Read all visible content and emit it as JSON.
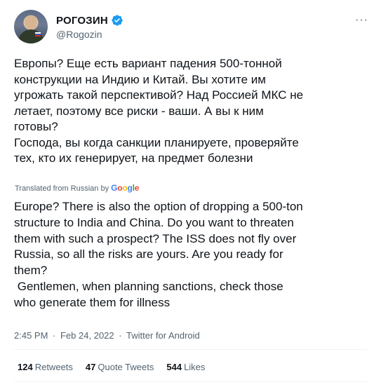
{
  "author": {
    "display_name": "РОГОЗИН",
    "handle": "@Rogozin",
    "verified_icon": "verified-badge-icon",
    "avatar_icon": "profile-photo"
  },
  "more_icon": "···",
  "tweet": {
    "original_text": "Европы? Еще есть вариант падения 500-тонной\nконструкции на Индию и Китай. Вы хотите им\nугрожать такой перспективой? Над Россией МКС не\nлетает, поэтому все риски - ваши. А вы к ним\nготовы?\nГоспода, вы когда санкции планируете, проверяйте\nтех, кто их генерирует, на предмет болезни",
    "translated_from": "Translated from Russian by",
    "translation_provider": "Google",
    "translated_text": "Europe? There is also the option of dropping a 500-ton\nstructure to India and China. Do you want to threaten\nthem with such a prospect? The ISS does not fly over\nRussia, so all the risks are yours. Are you ready for\nthem?\n Gentlemen, when planning sanctions, check those\nwho generate them for illness"
  },
  "meta": {
    "time": "2:45 PM",
    "date": "Feb 24, 2022",
    "separator": "·",
    "source": "Twitter for Android"
  },
  "stats": {
    "retweets_count": "124",
    "retweets_label": "Retweets",
    "quote_count": "47",
    "quote_label": "Quote Tweets",
    "likes_count": "544",
    "likes_label": "Likes"
  },
  "colors": {
    "text": "#0f1419",
    "secondary": "#536471",
    "verified": "#1d9bf0",
    "divider": "#eff3f4"
  }
}
